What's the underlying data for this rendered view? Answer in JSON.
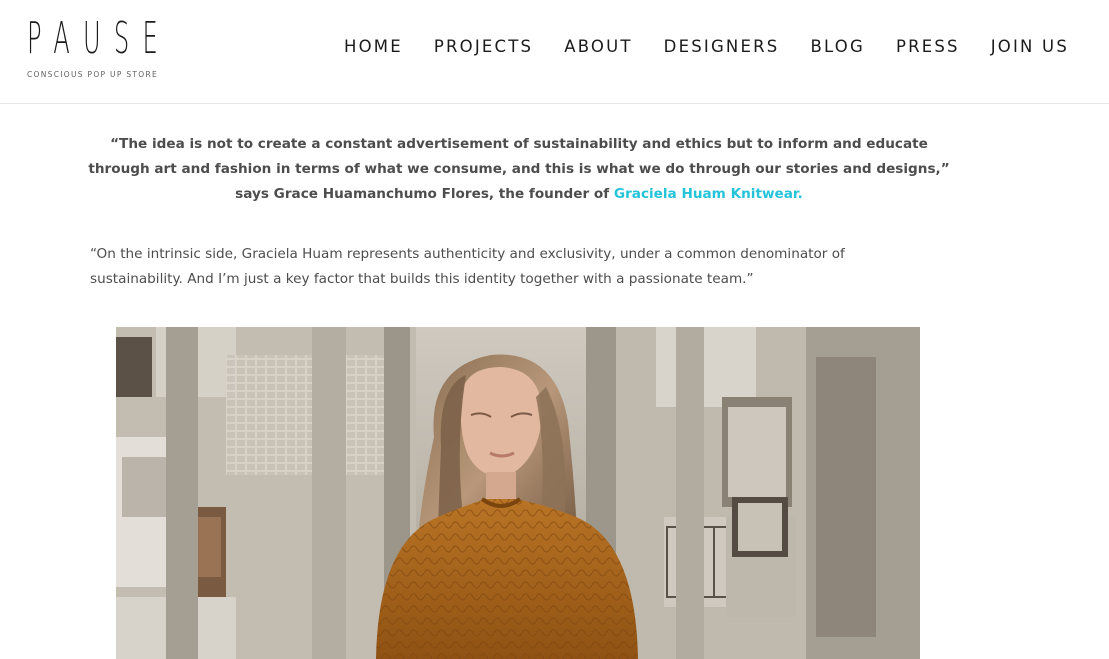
{
  "logo": {
    "wordmark": "PAUSE",
    "tagline": "CONSCIOUS POP UP STORE"
  },
  "nav": {
    "items": [
      {
        "label": "HOME"
      },
      {
        "label": "PROJECTS"
      },
      {
        "label": "ABOUT"
      },
      {
        "label": "DESIGNERS"
      },
      {
        "label": "BLOG"
      },
      {
        "label": "PRESS"
      },
      {
        "label": "JOIN US"
      }
    ]
  },
  "article": {
    "quote_text": "“The idea is not to create a constant advertisement of sustainability and ethics but to inform and educate through art and fashion in terms of what we consume, and this is what we do through our stories and designs,” says Grace Huamanchumo Flores, the founder of ",
    "quote_link": "Graciela Huam Knitwear.",
    "paragraph": "“On the intrinsic side, Graciela Huam represents authenticity and exclusivity, under a common denominator of sustainability. And I’m just a key factor that builds this identity together with a passionate team.”"
  },
  "colors": {
    "link_accent": "#25c3d9",
    "text": "#4d4d4d",
    "nav_text": "#1b1b1b",
    "sweater": "#b06a1f"
  }
}
